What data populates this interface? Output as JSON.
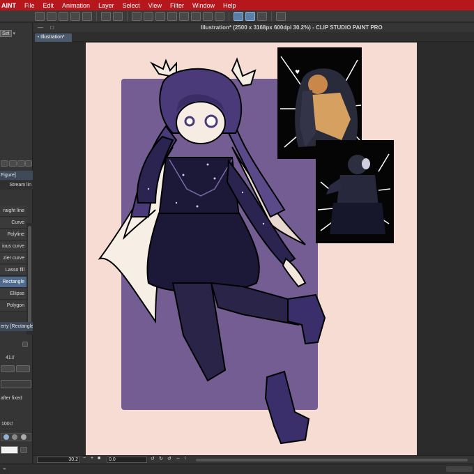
{
  "menubar": {
    "app": "AINT",
    "items": [
      "File",
      "Edit",
      "Animation",
      "Layer",
      "Select",
      "View",
      "Filter",
      "Window",
      "Help"
    ]
  },
  "document": {
    "title": "Illustration* (2500 x 3168px 600dpi 30.2%)  - CLIP STUDIO PAINT PRO",
    "tab": "Illustration*",
    "controls": "— □"
  },
  "left_panel": {
    "set_label": "Set",
    "figure_header": "Figure]",
    "stream_label": "Stream lin",
    "tools": [
      "raight line",
      "Curve",
      "Polyline",
      "ious curve",
      "zier curve",
      "Lasso fill",
      "Rectangle",
      "Ellipse",
      "Polygon"
    ],
    "selected_tool": "Rectangle",
    "property_header": "erty [Rectangle",
    "size_value": "41",
    "after_fixed": "after fixed",
    "opacity_value": "100"
  },
  "status": {
    "zoom": "30.2",
    "rotation": "0.0"
  },
  "colors": {
    "menubar": "#b5171d",
    "canvas_bg": "#f6dcd2",
    "purple_rect": "#735d92",
    "outfit_dark": "#1c1838",
    "hair": "#4a3a7a"
  }
}
